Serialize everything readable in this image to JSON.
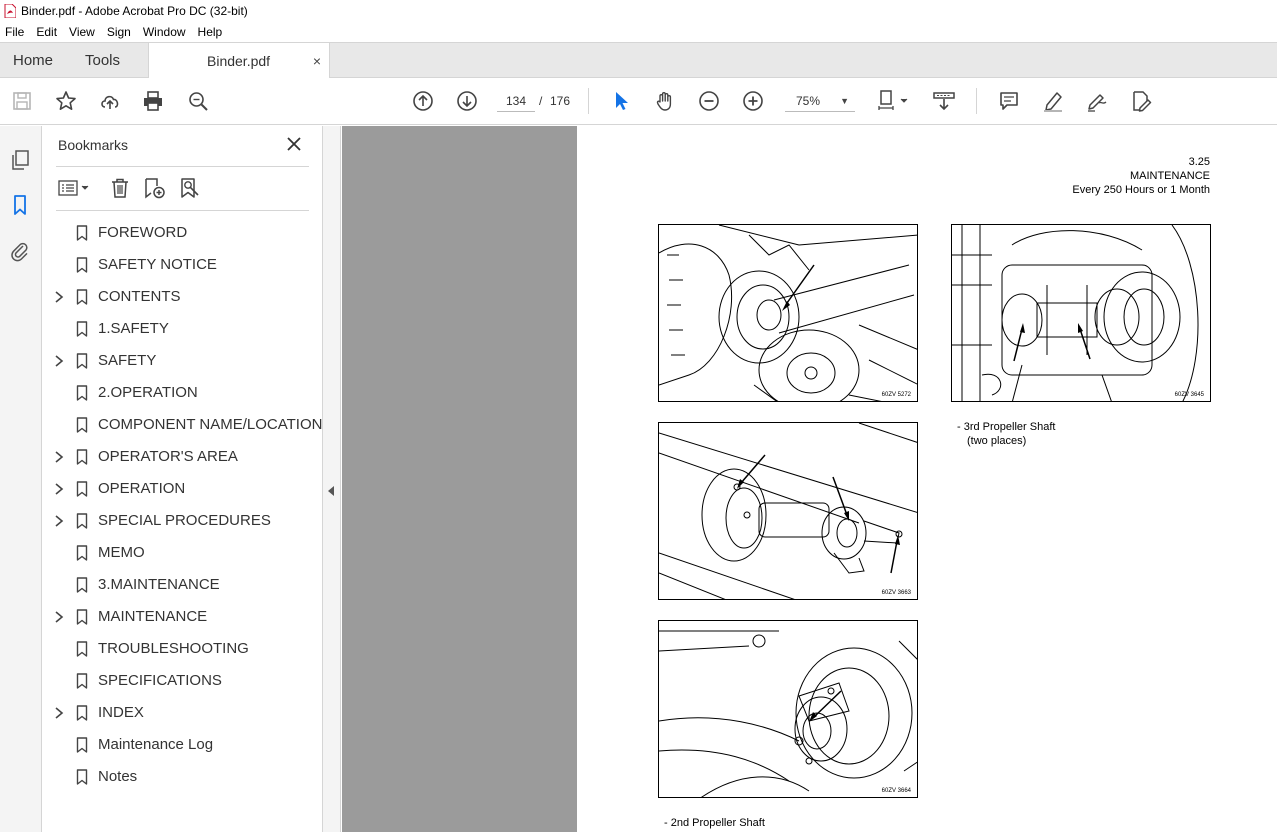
{
  "window": {
    "title": "Binder.pdf - Adobe Acrobat Pro DC (32-bit)"
  },
  "menu": [
    "File",
    "Edit",
    "View",
    "Sign",
    "Window",
    "Help"
  ],
  "tabs": {
    "home": "Home",
    "tools": "Tools",
    "document": "Binder.pdf",
    "close": "×"
  },
  "toolbar": {
    "current_page": "134",
    "page_separator": "/",
    "total_pages": "176",
    "zoom": "75%"
  },
  "bookmarks": {
    "title": "Bookmarks",
    "items": [
      {
        "label": "FOREWORD",
        "expandable": false
      },
      {
        "label": "SAFETY NOTICE",
        "expandable": false
      },
      {
        "label": "CONTENTS",
        "expandable": true
      },
      {
        "label": "1.SAFETY",
        "expandable": false
      },
      {
        "label": "SAFETY",
        "expandable": true
      },
      {
        "label": "2.OPERATION",
        "expandable": false
      },
      {
        "label": "COMPONENT NAME/LOCATION",
        "expandable": false
      },
      {
        "label": "OPERATOR'S AREA",
        "expandable": true
      },
      {
        "label": "OPERATION",
        "expandable": true
      },
      {
        "label": "SPECIAL PROCEDURES",
        "expandable": true
      },
      {
        "label": "MEMO",
        "expandable": false
      },
      {
        "label": "3.MAINTENANCE",
        "expandable": false
      },
      {
        "label": "MAINTENANCE",
        "expandable": true
      },
      {
        "label": "TROUBLESHOOTING",
        "expandable": false
      },
      {
        "label": "SPECIFICATIONS",
        "expandable": false
      },
      {
        "label": "INDEX",
        "expandable": true
      },
      {
        "label": "Maintenance Log",
        "expandable": false
      },
      {
        "label": "Notes",
        "expandable": false
      }
    ]
  },
  "document": {
    "page_number": "3.25",
    "section": "MAINTENANCE",
    "interval": "Every 250 Hours or 1 Month",
    "figures": [
      {
        "code": "60ZV 5272"
      },
      {
        "code": "60ZV 3645"
      },
      {
        "code": "60ZV 3663"
      },
      {
        "code": "60ZV 3664"
      }
    ],
    "caption_right": {
      "line1": "-  3rd Propeller Shaft",
      "line2": "(two places)"
    },
    "caption_bottom": "-  2nd Propeller Shaft"
  }
}
